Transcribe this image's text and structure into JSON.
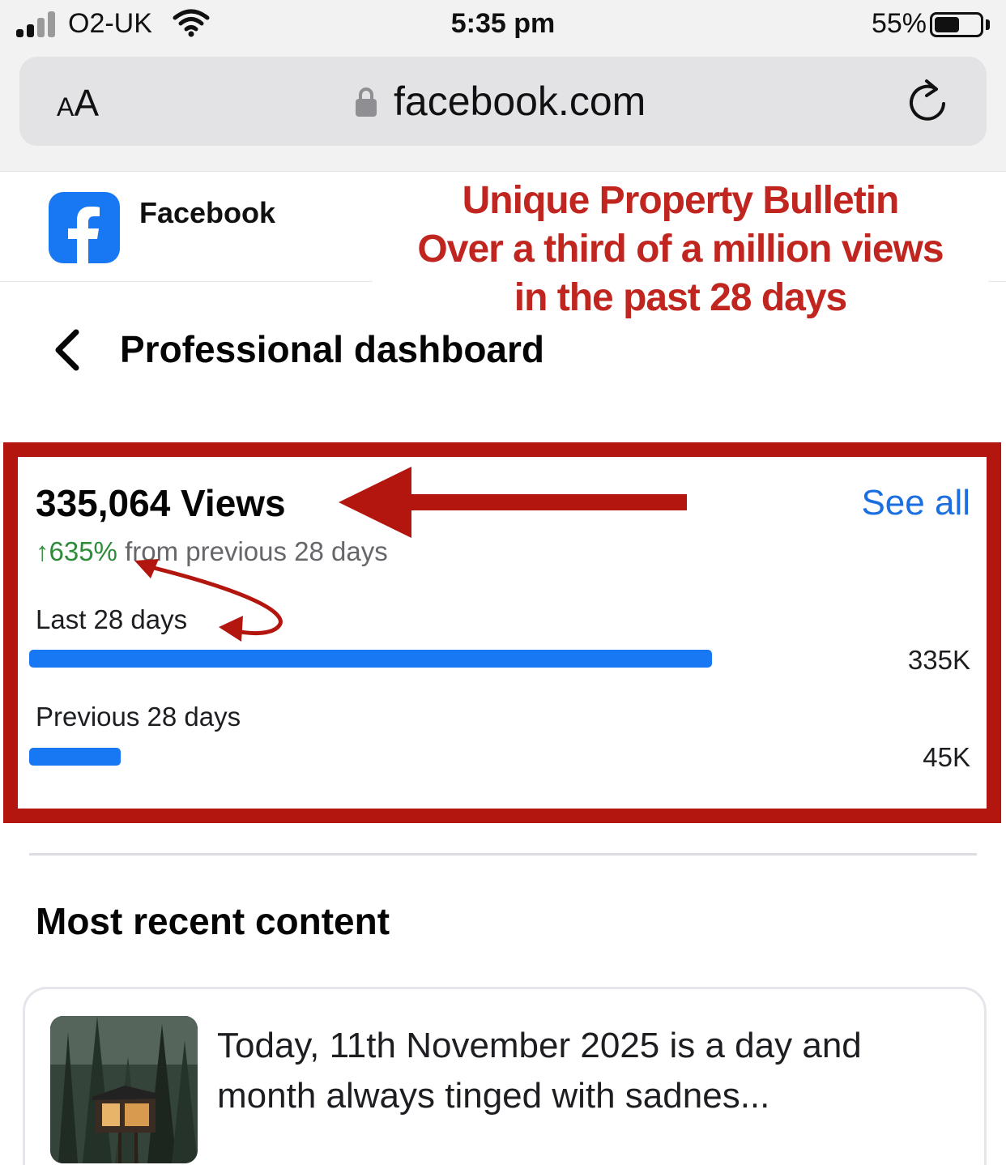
{
  "status_bar": {
    "carrier": "O2-UK",
    "time": "5:35 pm",
    "battery_percent": "55%",
    "battery_level": 0.55
  },
  "browser": {
    "text_size_small": "A",
    "text_size_large": "A",
    "domain": "facebook.com"
  },
  "banner": {
    "app_name": "Facebook",
    "brand_color": "#1877f2"
  },
  "annotation": {
    "lines": [
      "Unique Property Bulletin",
      "Over a third of a million views",
      "in the past 28 days"
    ],
    "color": "#c0261f"
  },
  "header": {
    "title": "Professional dashboard"
  },
  "views_card": {
    "total": "335,064 Views",
    "see_all": "See all",
    "change_arrow": "↑",
    "change_value": "635%",
    "change_text": "from previous 28 days",
    "rows": [
      {
        "label": "Last 28 days",
        "value": "335K",
        "amount": 335000
      },
      {
        "label": "Previous 28 days",
        "value": "45K",
        "amount": 45000
      }
    ]
  },
  "recent": {
    "title": "Most recent content",
    "post_text": "Today, 11th November 2025 is a day and month always tinged with sadnes..."
  }
}
